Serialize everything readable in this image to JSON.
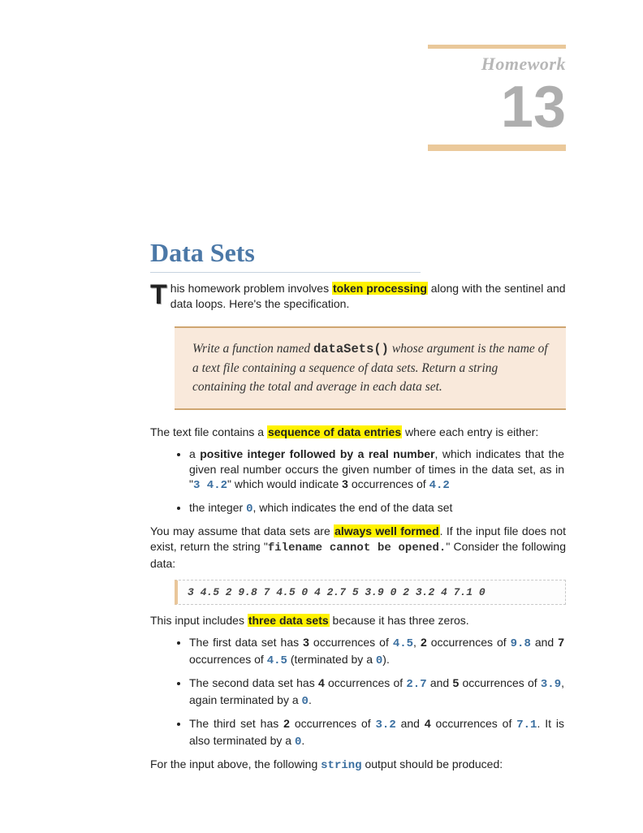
{
  "header": {
    "label": "Homework",
    "number": "13"
  },
  "title": "Data Sets",
  "intro": {
    "dropcap": "T",
    "t1": "his homework problem involves ",
    "hl1": "token processing",
    "t2": " along with the sentinel and data loops. Here's the specification."
  },
  "spec": {
    "t1": "Write a function named ",
    "fn": "dataSets()",
    "t2": " whose argument is the name of a text file containing a sequence of data sets. Return a string containing the total and average in each data set."
  },
  "body1": {
    "t1": "The text file contains a ",
    "hl": "sequence of data entries",
    "t2": " where each entry is either:"
  },
  "entry_list": {
    "item1": {
      "t1": "a ",
      "b1": "positive integer followed by a real number",
      "t2": ", which indicates that the given real number occurs the given number of times in the data set, as in \"",
      "c1": "3 4.2",
      "t3": "\" which would indicate ",
      "b2": "3",
      "t4": " occurrences of ",
      "c2": "4.2"
    },
    "item2": {
      "t1": "the integer ",
      "c1": "0",
      "t2": ", which indicates the end of the data set"
    }
  },
  "body2": {
    "t1": "You may assume that data sets are ",
    "hl": "always well formed",
    "t2": ". If the input file does not exist, return the string \"",
    "fn": "filename",
    "msg": " cannot be opened.",
    "t3": "\" Consider the following data:"
  },
  "code1": "3 4.5 2 9.8 7 4.5 0 4 2.7 5 3.9 0 2 3.2 4 7.1 0",
  "body3": {
    "t1": "This input includes ",
    "hl": "three data sets",
    "t2": " because it has three zeros."
  },
  "set_list": {
    "item1": {
      "t1": "The first data set has ",
      "b1": "3",
      "t2": " occurrences of ",
      "c1": "4.5",
      "t3": ", ",
      "b2": "2",
      "t4": " occurrences of ",
      "c2": "9.8",
      "t5": " and ",
      "b3": "7",
      "t6": " occurrences of ",
      "c3": "4.5",
      "t7": " (terminated by a ",
      "c4": "0",
      "t8": ")."
    },
    "item2": {
      "t1": "The second data set has ",
      "b1": "4",
      "t2": " occurrences of ",
      "c1": "2.7",
      "t3": " and ",
      "b2": "5",
      "t4": " occurrences of ",
      "c2": "3.9",
      "t5": ", again terminated by a ",
      "c3": "0",
      "t6": "."
    },
    "item3": {
      "t1": "The third set has ",
      "b1": "2",
      "t2": " occurrences of ",
      "c1": "3.2",
      "t3": " and ",
      "b2": "4",
      "t4": " occurrences of ",
      "c2": "7.1",
      "t5": ". It is also terminated by a ",
      "c3": "0",
      "t6": "."
    }
  },
  "body4": {
    "t1": "For the input above, the following ",
    "c1": "string",
    "t2": " output should be produced:"
  }
}
